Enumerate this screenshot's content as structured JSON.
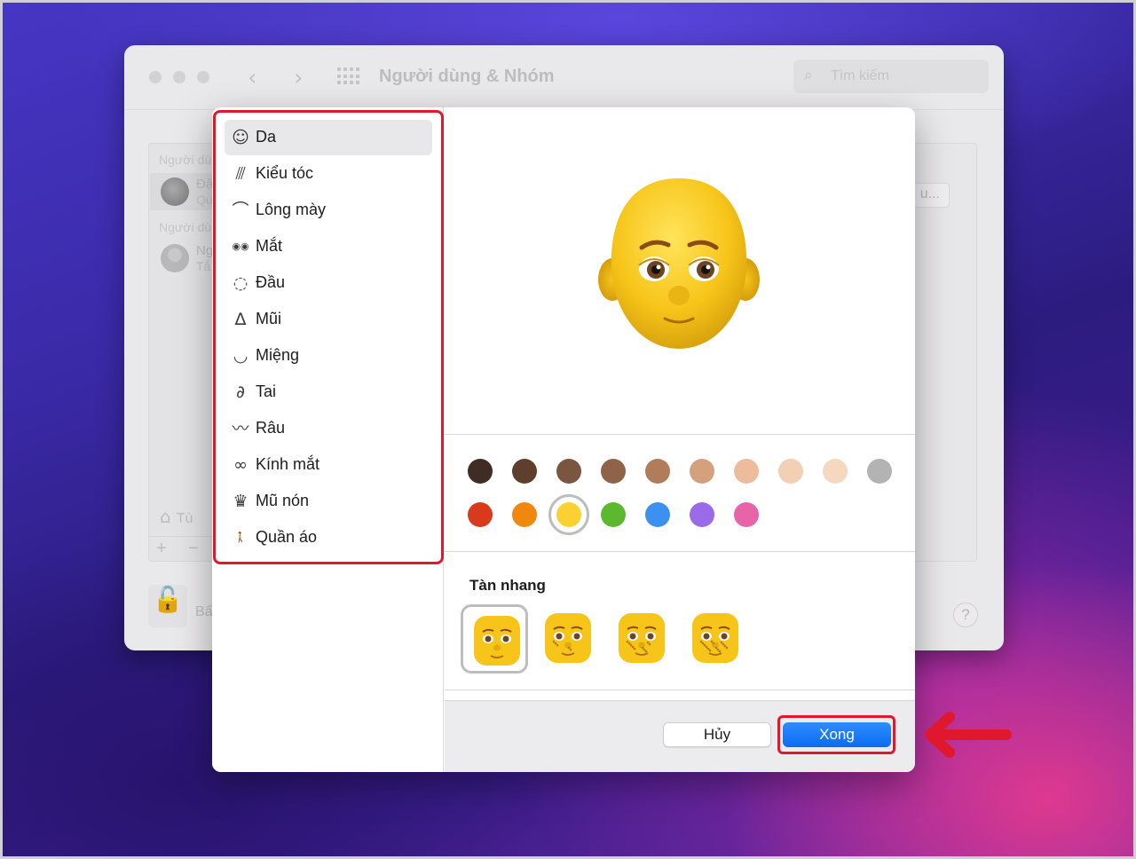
{
  "background_window": {
    "title": "Người dùng & Nhóm",
    "search_placeholder": "Tìm kiếm",
    "section_current": "Người dù",
    "current_user_line1": "Đặ",
    "current_user_line2": "Qu",
    "section_other": "Người dù",
    "other_user_line1": "Ng",
    "other_user_line2": "Tắ",
    "login_options": "Tù",
    "add_symbol": "+",
    "remove_symbol": "−",
    "right_button": "u...",
    "lock_text": "Bấ",
    "help_symbol": "?"
  },
  "dialog": {
    "categories": [
      {
        "label": "Da",
        "icon": "face-icon"
      },
      {
        "label": "Kiểu tóc",
        "icon": "comb-icon"
      },
      {
        "label": "Lông mày",
        "icon": "eyebrow-icon"
      },
      {
        "label": "Mắt",
        "icon": "eyes-icon"
      },
      {
        "label": "Đầu",
        "icon": "head-outline-icon"
      },
      {
        "label": "Mũi",
        "icon": "nose-icon"
      },
      {
        "label": "Miệng",
        "icon": "lips-icon"
      },
      {
        "label": "Tai",
        "icon": "ear-icon"
      },
      {
        "label": "Râu",
        "icon": "mustache-icon"
      },
      {
        "label": "Kính mắt",
        "icon": "glasses-icon"
      },
      {
        "label": "Mũ nón",
        "icon": "crown-icon"
      },
      {
        "label": "Quần áo",
        "icon": "walking-person-icon"
      }
    ],
    "selected_category": "Da",
    "skin_colors_row1": [
      "#3e2c25",
      "#5e3f2e",
      "#7a5540",
      "#8f6348",
      "#b07c5a",
      "#d4a17e",
      "#ecbc9c",
      "#f3cfb3",
      "#f6d8c0",
      "#b3b3b3"
    ],
    "skin_colors_row2": [
      "#d93a1c",
      "#f0880f",
      "#fbd132",
      "#5cb82c",
      "#3b90f0",
      "#9a6be8",
      "#e864a8"
    ],
    "selected_color": "#fbd132",
    "freckles_title": "Tàn nhang",
    "freckle_options": 4,
    "freckle_selected_index": 0,
    "cancel_label": "Hủy",
    "done_label": "Xong",
    "accent_color": "#0a6cf0",
    "highlight_color": "#e0182d"
  }
}
